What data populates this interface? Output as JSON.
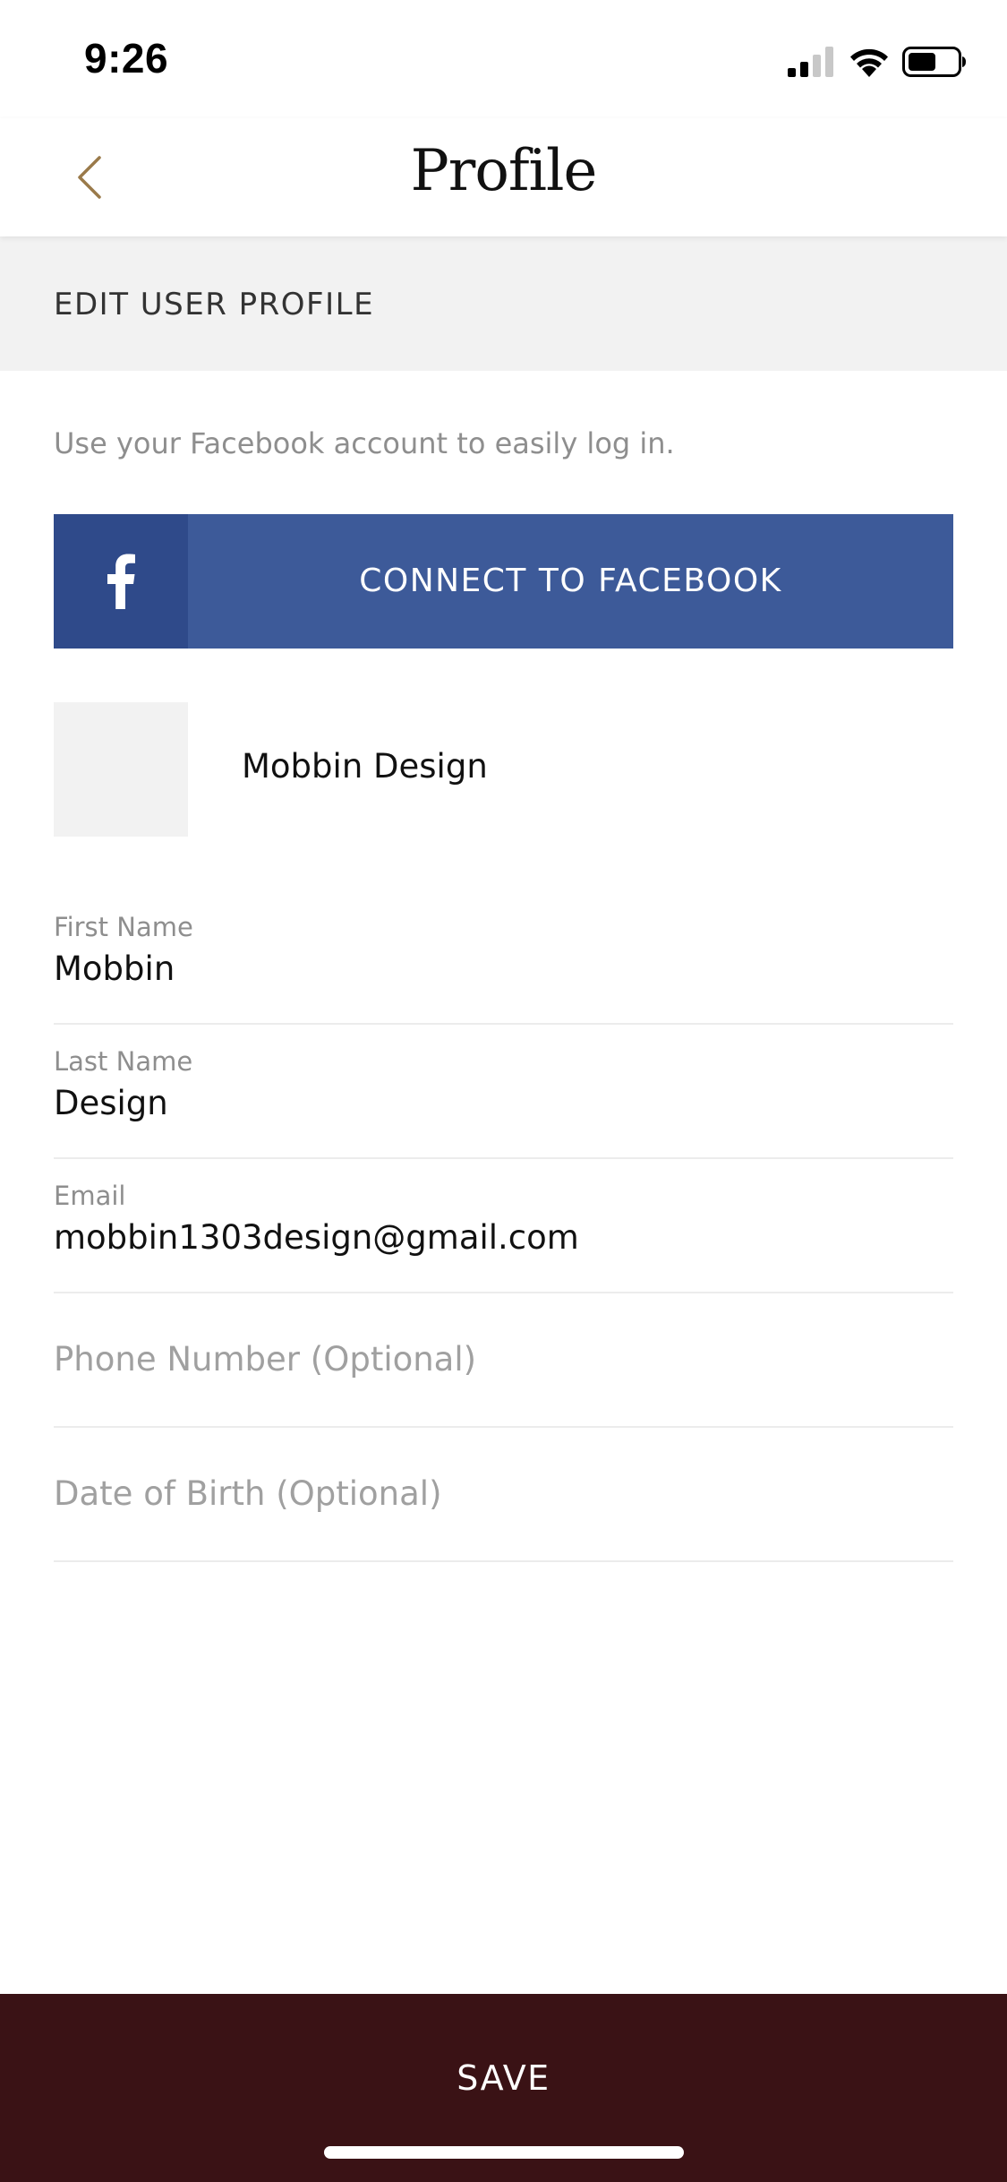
{
  "status_bar": {
    "time": "9:26",
    "signal_icon": "cellular-signal-icon",
    "wifi_icon": "wifi-icon",
    "battery_icon": "battery-icon"
  },
  "nav": {
    "title": "Profile",
    "back_icon": "chevron-left-icon"
  },
  "section": {
    "header": "EDIT USER PROFILE"
  },
  "facebook": {
    "hint": "Use your Facebook account to easily log in.",
    "button_label": "CONNECT TO FACEBOOK",
    "icon": "facebook-icon"
  },
  "profile": {
    "display_name": "Mobbin Design"
  },
  "fields": {
    "first_name": {
      "label": "First Name",
      "value": "Mobbin"
    },
    "last_name": {
      "label": "Last Name",
      "value": "Design"
    },
    "email": {
      "label": "Email",
      "value": "mobbin1303design@gmail.com"
    },
    "phone": {
      "placeholder": "Phone Number (Optional)"
    },
    "dob": {
      "placeholder": "Date of Birth (Optional)"
    }
  },
  "footer": {
    "save_label": "SAVE"
  },
  "colors": {
    "accent_gold": "#9a7a4a",
    "facebook_blue": "#3d5a99",
    "facebook_blue_dark": "#2f4a8a",
    "save_bar": "#3a1215",
    "section_bg": "#f2f2f2"
  }
}
